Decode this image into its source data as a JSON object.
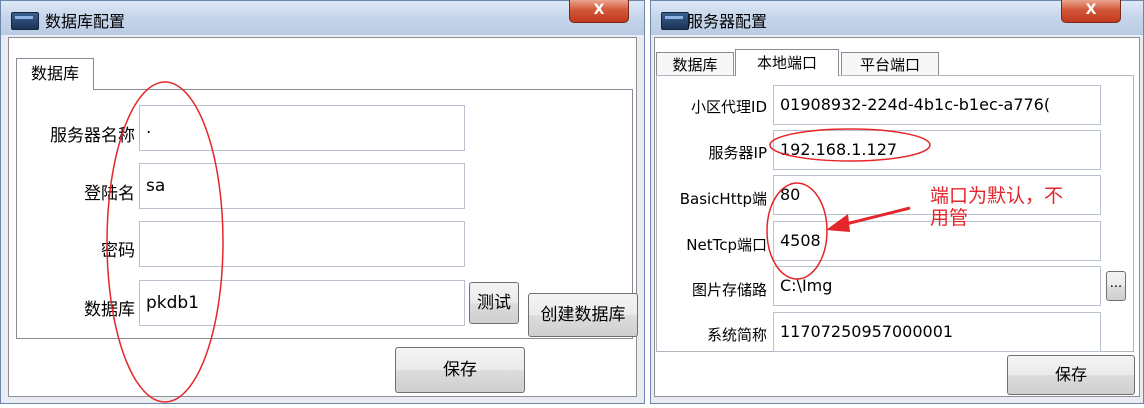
{
  "db_window": {
    "title": "数据库配置",
    "close_label": "X",
    "tab": "数据库",
    "fields": [
      {
        "label": "服务器名称",
        "value": "."
      },
      {
        "label": "登陆名",
        "value": "sa"
      },
      {
        "label": "密码",
        "value": ""
      },
      {
        "label": "数据库",
        "value": "pkdb1"
      }
    ],
    "test_button": "测试",
    "create_db_button": "创建数据库",
    "save_button": "保存"
  },
  "server_window": {
    "title": "服务器配置",
    "close_label": "X",
    "tabs": [
      "数据库",
      "本地端口",
      "平台端口"
    ],
    "active_tab": "本地端口",
    "fields": [
      {
        "label": "小区代理ID",
        "value": "01908932-224d-4b1c-b1ec-a776("
      },
      {
        "label": "服务器IP",
        "value": "192.168.1.127"
      },
      {
        "label": "BasicHttp端",
        "value": "80"
      },
      {
        "label": "NetTcp端口",
        "value": "4508"
      },
      {
        "label": "图片存储路",
        "value": "C:\\Img"
      },
      {
        "label": "系统简称",
        "value": "11707250957000001"
      }
    ],
    "browse_button": "...",
    "save_button": "保存"
  },
  "annotation": {
    "line1": "端口为默认，不",
    "line2": "用管",
    "color": "#e4262a"
  }
}
